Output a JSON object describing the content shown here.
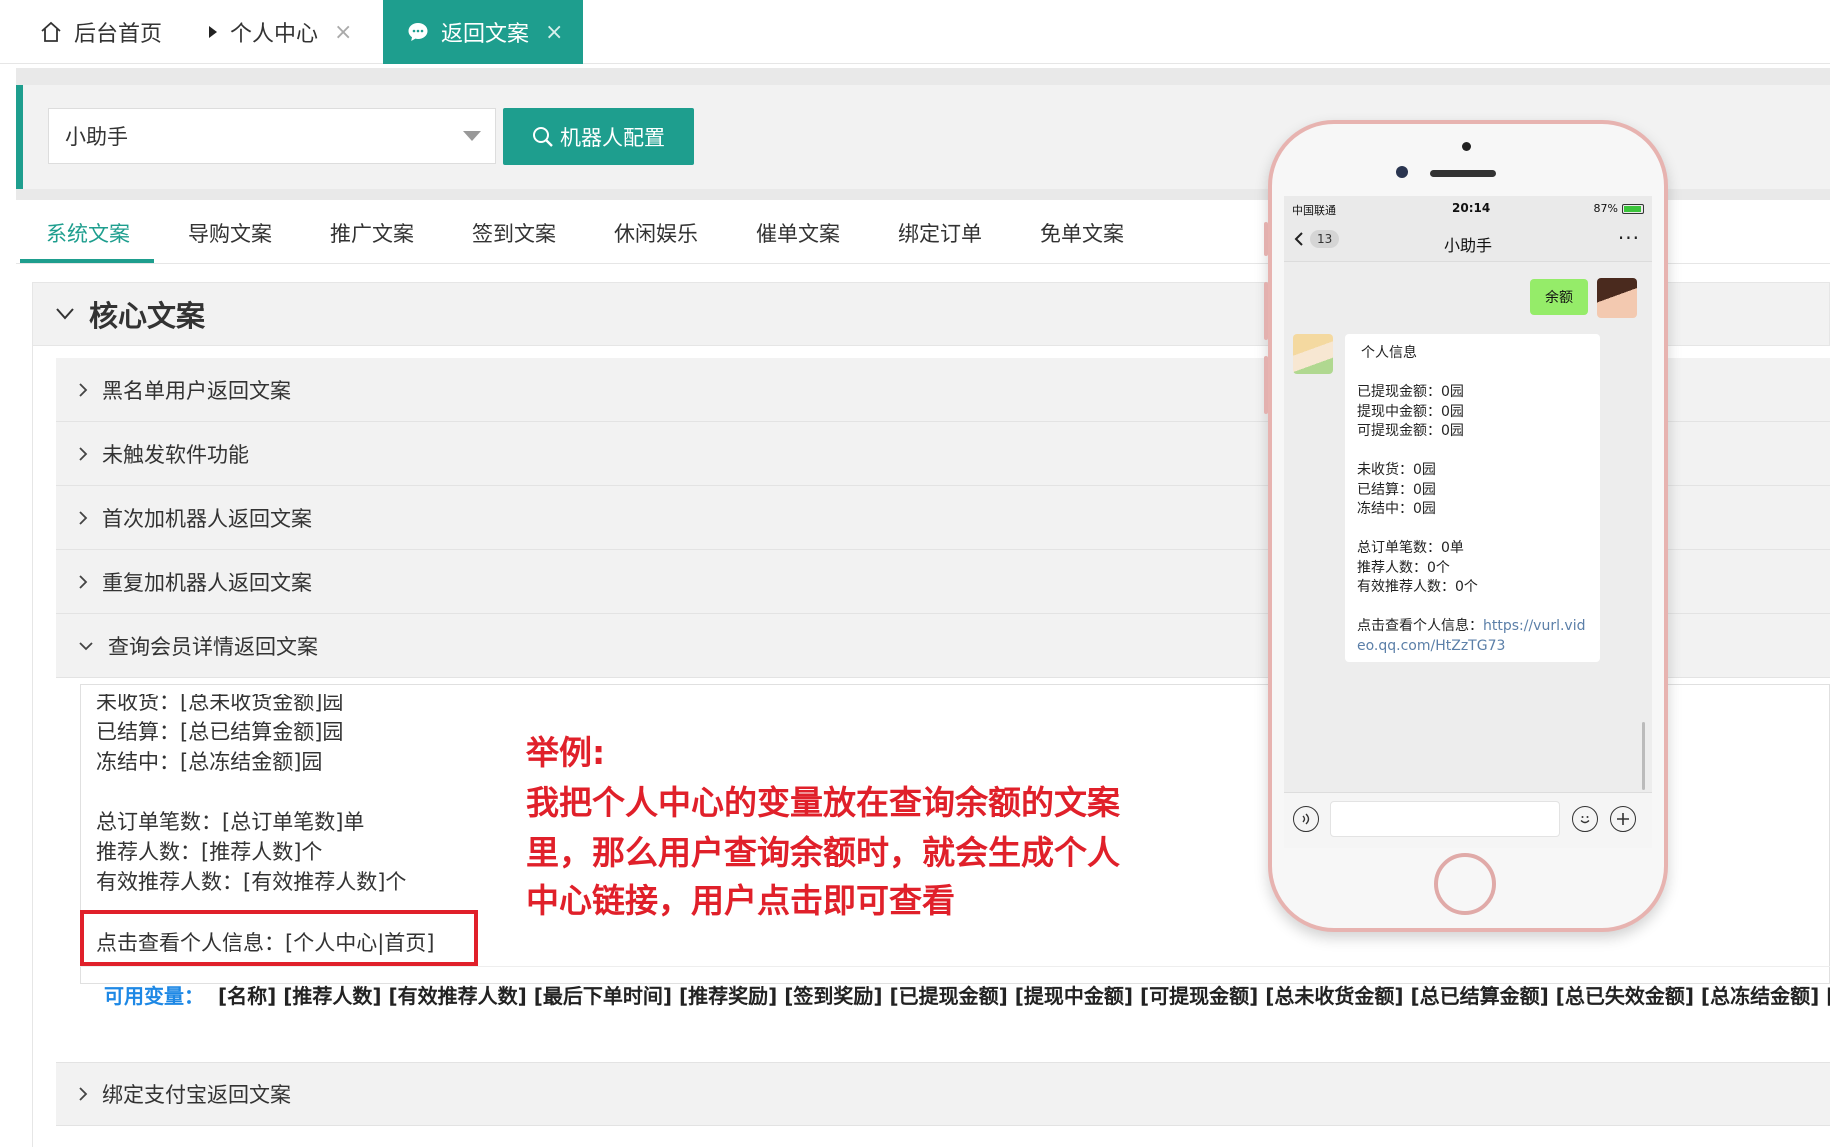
{
  "tabs": {
    "home": "后台首页",
    "center": "个人中心",
    "active": "返回文案",
    "close_glyph": "×"
  },
  "toolbar": {
    "select_value": "小助手",
    "robot_button": "机器人配置"
  },
  "subtabs": [
    "系统文案",
    "导购文案",
    "推广文案",
    "签到文案",
    "休闲娱乐",
    "催单文案",
    "绑定订单",
    "免单文案"
  ],
  "core": {
    "title": "核心文案",
    "items": [
      "黑名单用户返回文案",
      "未触发软件功能",
      "首次加机器人返回文案",
      "重复加机器人返回文案",
      "查询会员详情返回文案"
    ],
    "last_item": "绑定支付宝返回文案"
  },
  "editor": {
    "lines": [
      "未收货：[总未收货金额]园",
      "已结算：[总已结算金额]园",
      "冻结中：[总冻结金额]园",
      "总订单笔数：[总订单笔数]单",
      "推荐人数：[推荐人数]个",
      "有效推荐人数：[有效推荐人数]个",
      "点击查看个人信息：[个人中心|首页]"
    ],
    "vars_label": "可用变量：",
    "vars": "[名称] [推荐人数] [有效推荐人数] [最后下单时间] [推荐奖励] [签到奖励] [已提现金额] [提现中金额] [可提现金额] [总未收货金额] [总已结算金额] [总已失效金额] [总冻结金额] ["
  },
  "annotation": {
    "line1": "举例:",
    "line2": "我把个人中心的变量放在查询余额的文案",
    "line3": "里，那么用户查询余额时，就会生成个人",
    "line4": "中心链接，用户点击即可查看"
  },
  "phone": {
    "carrier": "中国联通",
    "time": "20:14",
    "battery": "87%",
    "back_badge": "13",
    "chat_title": "小助手",
    "more": "···",
    "my_message": "余额",
    "reply": {
      "title": "个人信息",
      "l1": "已提现金额：0园",
      "l2": "提现中金额：0园",
      "l3": "可提现金额：0园",
      "l4": "未收货：0园",
      "l5": "已结算：0园",
      "l6": "冻结中：0园",
      "l7": "总订单笔数：0单",
      "l8": "推荐人数：0个",
      "l9": "有效推荐人数：0个",
      "l10": "点击查看个人信息：",
      "link": "https://vurl.video.qq.com/HtZzTG73"
    }
  },
  "colors": {
    "accent": "#1e9e8e",
    "annotation": "#e0202a",
    "vars_label": "#1e88e5"
  }
}
